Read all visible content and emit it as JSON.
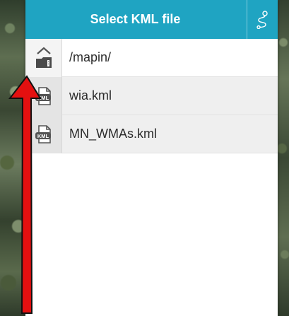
{
  "dialog": {
    "title": "Select KML file",
    "action_icon": "route-icon"
  },
  "files": [
    {
      "label": "/mapin/",
      "type": "folder-up",
      "icon": "folder-up-icon"
    },
    {
      "label": "wia.kml",
      "type": "kml",
      "icon": "kml-file-icon",
      "icon_text": "KML"
    },
    {
      "label": "MN_WMAs.kml",
      "type": "kml",
      "icon": "kml-file-icon",
      "icon_text": "KML"
    }
  ],
  "colors": {
    "header": "#1fa4c2",
    "row_alt": "#efefef",
    "annotation_arrow": "#e41010"
  },
  "annotation": {
    "icon": "arrow-up-icon"
  }
}
